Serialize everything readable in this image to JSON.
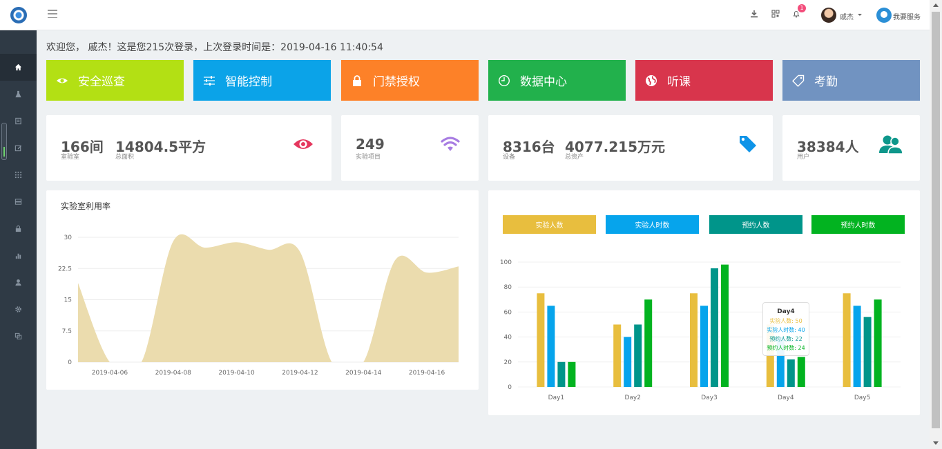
{
  "header": {
    "user_name": "戚杰",
    "service_label": "我要服务",
    "notification_count": "1"
  },
  "welcome_text": "欢迎您， 戚杰！这是您215次登录，上次登录时间是：2019-04-16 11:40:54",
  "tiles": [
    {
      "label": "安全巡查",
      "color": "#b3e014",
      "icon": "eye-icon"
    },
    {
      "label": "智能控制",
      "color": "#0ba3e8",
      "icon": "sliders-icon"
    },
    {
      "label": "门禁授权",
      "color": "#fd8128",
      "icon": "lock-icon"
    },
    {
      "label": "数据中心",
      "color": "#22b14c",
      "icon": "clock-icon"
    },
    {
      "label": "听课",
      "color": "#d8354c",
      "icon": "globe-icon"
    },
    {
      "label": "考勤",
      "color": "#7193c1",
      "icon": "tag-icon"
    }
  ],
  "stats": {
    "labs": {
      "value": "166间",
      "label": "室验室"
    },
    "area": {
      "value": "14804.5平方",
      "label": "总面积"
    },
    "projects": {
      "value": "249",
      "label": "实验项目"
    },
    "devices": {
      "value": "8316台",
      "label": "设备"
    },
    "assets": {
      "value": "4077.215万元",
      "label": "总资产"
    },
    "users": {
      "value": "38384人",
      "label": "用户"
    }
  },
  "colors": {
    "area_fill": "#ebdcae",
    "series": [
      "#e8be3e",
      "#06a4ec",
      "#00958a",
      "#02b320"
    ],
    "eye": "#e5375e",
    "wifi": "#a77ce2",
    "tag": "#0f94e8",
    "users": "#0e978b"
  },
  "chart_data": [
    {
      "type": "area",
      "title": "实验室利用率",
      "x": [
        "2019-04-05",
        "2019-04-06",
        "2019-04-07",
        "2019-04-08",
        "2019-04-09",
        "2019-04-10",
        "2019-04-11",
        "2019-04-12",
        "2019-04-13",
        "2019-04-14",
        "2019-04-15",
        "2019-04-16",
        "2019-04-17"
      ],
      "x_tick_labels": [
        "2019-04-06",
        "2019-04-08",
        "2019-04-10",
        "2019-04-12",
        "2019-04-14",
        "2019-04-16"
      ],
      "values": [
        19,
        0,
        0,
        29,
        27.5,
        28.8,
        27,
        26.5,
        0,
        0,
        24.5,
        21.5,
        23
      ],
      "y_ticks": [
        "0",
        "7.5",
        "15",
        "22.5",
        "30"
      ],
      "ylim": [
        0,
        30
      ],
      "grid": true
    },
    {
      "type": "bar",
      "categories": [
        "Day1",
        "Day2",
        "Day3",
        "Day4",
        "Day5"
      ],
      "series": [
        {
          "name": "实验人数",
          "values": [
            75,
            50,
            75,
            50,
            75
          ]
        },
        {
          "name": "实验人时数",
          "values": [
            65,
            40,
            65,
            40,
            65
          ]
        },
        {
          "name": "预约人数",
          "values": [
            20,
            50,
            95,
            22,
            56
          ]
        },
        {
          "name": "预约人时数",
          "values": [
            20,
            70,
            98,
            24,
            70
          ]
        }
      ],
      "y_ticks": [
        "0",
        "20",
        "40",
        "60",
        "80",
        "100"
      ],
      "ylim": [
        0,
        100
      ],
      "legend_position": "top",
      "tooltip": {
        "title": "Day4",
        "lines": [
          "实验人数: 50",
          "实验人时数: 40",
          "预约人数: 22",
          "预约人时数: 24"
        ]
      }
    }
  ]
}
